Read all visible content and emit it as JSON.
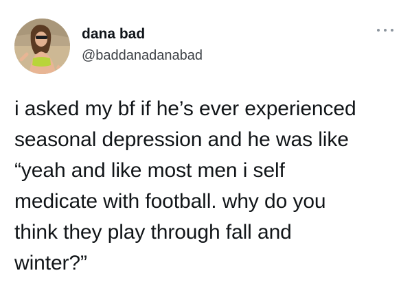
{
  "tweet": {
    "author": {
      "display_name": "dana bad",
      "handle": "@baddanadanabad",
      "avatar_icon": "avatar-photo"
    },
    "menu_icon": "more-options-icon",
    "text_lines": [
      "i asked my bf if he’s ever experienced",
      "seasonal depression and he was like",
      "“yeah and like most men i self",
      "medicate with football. why do you",
      "think they play through fall and",
      "winter?”"
    ]
  },
  "colors": {
    "background": "#ffffff",
    "text": "#0f1419",
    "secondary_text": "#3b3f44",
    "menu_dots": "#8c959e"
  }
}
